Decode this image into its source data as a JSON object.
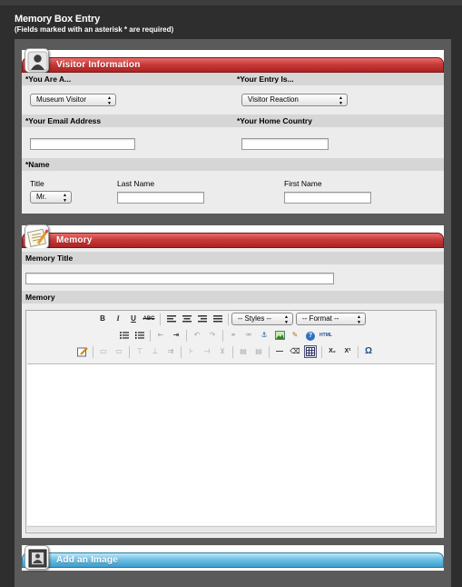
{
  "header": {
    "title": "Memory Box Entry",
    "subtitle": "(Fields marked with an asterisk * are required)"
  },
  "visitor": {
    "title": "Visitor Information",
    "you_are_label": "*You Are A...",
    "you_are_value": "Museum Visitor",
    "entry_label": "*Your Entry Is...",
    "entry_value": "Visitor Reaction",
    "email_label": "*Your Email Address",
    "email_value": "",
    "country_label": "*Your Home Country",
    "country_value": "",
    "name_label": "*Name",
    "title_label": "Title",
    "title_value": "Mr.",
    "last_name_label": "Last Name",
    "last_name_value": "",
    "first_name_label": "First Name",
    "first_name_value": ""
  },
  "memory": {
    "title": "Memory",
    "memory_title_label": "Memory Title",
    "memory_title_value": "",
    "memory_label": "Memory",
    "styles_value": "-- Styles --",
    "format_value": "-- Format --",
    "toolbar": {
      "bold": "B",
      "italic": "I",
      "underline": "U",
      "strike": "ABC",
      "html": "HTML",
      "subscript": "X₂",
      "superscript": "X²",
      "omega": "Ω",
      "rule": "—",
      "help": "?"
    }
  },
  "image_section": {
    "title": "Add an Image"
  },
  "colors": {
    "red_band": "#c93b3a",
    "blue_band": "#6cc2e6",
    "background": "#2e2e2e",
    "panel": "#5a5a5a"
  }
}
